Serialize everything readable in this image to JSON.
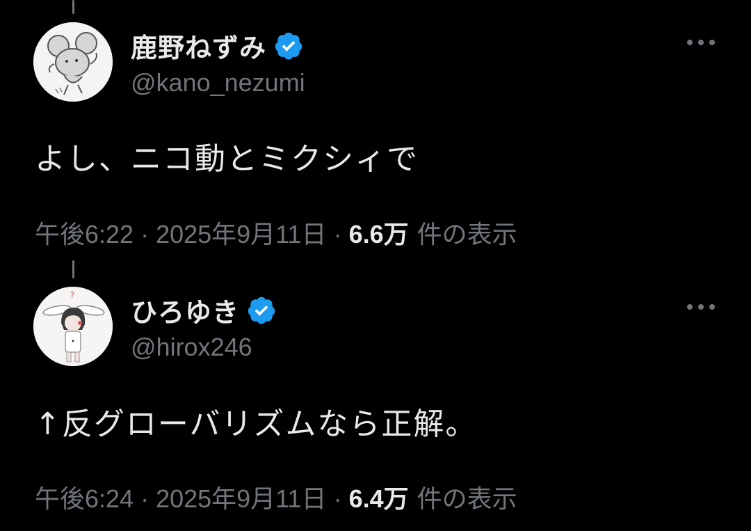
{
  "colors": {
    "background": "#000000",
    "primary_text": "#e7e9ea",
    "secondary_text": "#71767b",
    "verified_badge": "#1d9bf0"
  },
  "tweets": [
    {
      "display_name": "鹿野ねずみ",
      "handle": "@kano_nezumi",
      "verified": true,
      "verified_icon": "verified-badge-icon",
      "avatar_icon": "mouse-drawing-avatar",
      "text": "よし、ニコ動とミクシィで",
      "time": "午後6:22",
      "date": "2025年9月11日",
      "views_count": "6.6万",
      "views_label": "件の表示",
      "separator": "·",
      "more_icon": "more-options-icon"
    },
    {
      "display_name": "ひろゆき",
      "handle": "@hirox246",
      "verified": true,
      "verified_icon": "verified-badge-icon",
      "avatar_icon": "bunny-ear-character-avatar",
      "text": "↑反グローバリズムなら正解。",
      "time": "午後6:24",
      "date": "2025年9月11日",
      "views_count": "6.4万",
      "views_label": "件の表示",
      "separator": "·",
      "more_icon": "more-options-icon"
    }
  ]
}
